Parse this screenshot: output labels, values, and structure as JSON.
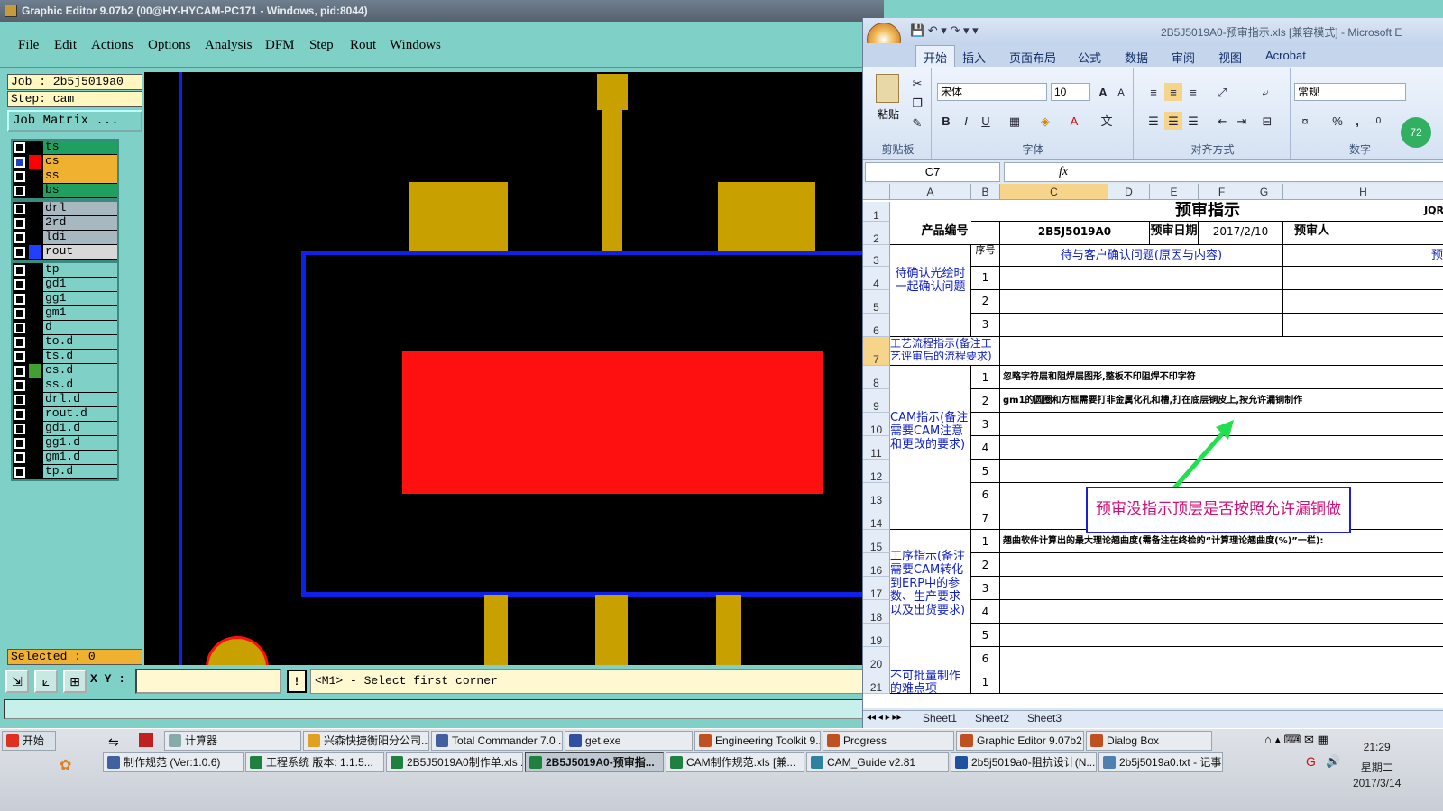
{
  "ge": {
    "title": "Graphic Editor 9.07b2 (00@HY-HYCAM-PC171 - Windows, pid:8044)",
    "menu": [
      "File",
      "Edit",
      "Actions",
      "Options",
      "Analysis",
      "DFM",
      "Step",
      "Rout",
      "Windows"
    ],
    "job_label": "Job : 2b5j5019a0",
    "step_label": "Step: cam",
    "job_matrix": "Job Matrix ...",
    "layers_group1": [
      {
        "name": "ts",
        "color": "#20a060",
        "checked": false,
        "edit": ""
      },
      {
        "name": "cs",
        "color": "#f0b030",
        "checked": true,
        "swatch": "#ff0000",
        "edit": "✎≡"
      },
      {
        "name": "ss",
        "color": "#f0b030",
        "checked": false,
        "edit": "✎"
      },
      {
        "name": "bs",
        "color": "#20a060",
        "checked": false,
        "edit": ""
      }
    ],
    "layers_group2": [
      {
        "name": "drl",
        "color": "#a8b8c0",
        "checked": false
      },
      {
        "name": "2rd",
        "color": "#a8b8c0",
        "checked": false
      },
      {
        "name": "ldi",
        "color": "#a8b8c0",
        "checked": false
      },
      {
        "name": "rout",
        "color": "#d8d8d8",
        "checked": false,
        "swatch": "#2040ff"
      }
    ],
    "layers_group3": [
      {
        "name": "tp",
        "edit": ""
      },
      {
        "name": "gd1",
        "edit": "✎"
      },
      {
        "name": "gg1",
        "edit": ""
      },
      {
        "name": "gm1",
        "edit": "✎"
      },
      {
        "name": "d",
        "edit": ""
      },
      {
        "name": "to.d",
        "edit": "✎"
      },
      {
        "name": "ts.d",
        "edit": ""
      },
      {
        "name": "cs.d",
        "edit": "✎",
        "swatch": "#40a030"
      },
      {
        "name": "ss.d",
        "edit": "✎"
      },
      {
        "name": "drl.d",
        "edit": ""
      },
      {
        "name": "rout.d",
        "edit": ""
      },
      {
        "name": "gd1.d",
        "edit": "✎"
      },
      {
        "name": "gg1.d",
        "edit": ""
      },
      {
        "name": "gm1.d",
        "edit": "✎"
      },
      {
        "name": "tp.d",
        "edit": ""
      }
    ],
    "selected": "Selected : 0",
    "xy_label": "X Y :",
    "bang": "!",
    "prompt": "<M1> - Select first corner",
    "colors": {
      "pad": "#c8a000",
      "fill": "#ff1010",
      "outline": "#1020e8",
      "bg": "#000000"
    }
  },
  "excel": {
    "title": "2B5J5019A0-预审指示.xls [兼容模式] - Microsoft E",
    "tabs": [
      "开始",
      "插入",
      "页面布局",
      "公式",
      "数据",
      "审阅",
      "视图",
      "Acrobat"
    ],
    "paste": "粘贴",
    "font_name": "宋体",
    "font_size": "10",
    "number_format": "常规",
    "groups": [
      "剪贴板",
      "字体",
      "对齐方式",
      "数字"
    ],
    "name_box": "C7",
    "fx": "fx",
    "columns": [
      "A",
      "B",
      "C",
      "D",
      "E",
      "F",
      "G",
      "H"
    ],
    "rows": [
      "1",
      "2",
      "3",
      "4",
      "5",
      "6",
      "7",
      "8",
      "9",
      "10",
      "11",
      "12",
      "13",
      "14",
      "15",
      "16",
      "17",
      "18",
      "19",
      "20",
      "21"
    ],
    "title_cell": "预审指示",
    "title_right": "JQR",
    "product_label": "产品编号",
    "product_value": "2B5J5019A0",
    "date_label": "预审日期",
    "date_value": "2017/2/10",
    "reviewer_label": "预审人",
    "seq_label": "序号",
    "pending_header": "待与客户确认问题(原因与内容)",
    "pending_right": "预",
    "sec_pending": "待确认光绘时一起确认问题",
    "sec_process": "工艺流程指示(备注工艺评审后的流程要求)",
    "sec_cam": "CAM指示(备注需要CAM注意和更改的要求)",
    "sec_work": "工序指示(备注需要CAM转化到ERP中的参数、生产要求以及出货要求)",
    "sec_hard": "不可批量制作的难点项",
    "cam_line1": "忽略字符层和阻焊层图形,整板不印阻焊不印字符",
    "cam_line2": "gm1的圆圈和方框需要打非金属化孔和槽,打在底层铜皮上,按允许漏铜制作",
    "work_line1": "翘曲软件计算出的最大理论翘曲度(需备注在终检的“计算理论翘曲度(%)”一栏):",
    "seq_nums_pending": [
      "1",
      "2",
      "3"
    ],
    "seq_nums_cam": [
      "1",
      "2",
      "3",
      "4",
      "5",
      "6",
      "7"
    ],
    "seq_nums_work": [
      "1",
      "2",
      "3",
      "4",
      "5",
      "6"
    ],
    "seq_nums_hard": [
      "1"
    ],
    "sheet_tabs": [
      "Sheet1",
      "Sheet2",
      "Sheet3"
    ],
    "callout": "预审没指示顶层是否按照允许漏铜做",
    "badge": "72"
  },
  "taskbar": {
    "start": "开始",
    "row1": [
      {
        "label": "计算器",
        "color": "#8aa"
      },
      {
        "label": "兴森快捷衡阳分公司...",
        "color": "#e0a020"
      },
      {
        "label": "Total Commander 7.0 ...",
        "color": "#4060a0"
      },
      {
        "label": "get.exe",
        "color": "#3050a0"
      },
      {
        "label": "Engineering Toolkit 9....",
        "color": "#c05020"
      },
      {
        "label": "Progress",
        "color": "#c05020"
      },
      {
        "label": "Graphic Editor 9.07b2 ...",
        "color": "#c05020"
      },
      {
        "label": "Dialog Box",
        "color": "#c05020"
      }
    ],
    "row2": [
      {
        "label": "制作规范 (Ver:1.0.6)",
        "color": "#4060a0"
      },
      {
        "label": "工程系统  版本: 1.1.5...",
        "color": "#208040"
      },
      {
        "label": "2B5J5019A0制作单.xls ...",
        "color": "#208040"
      },
      {
        "label": "2B5J5019A0-预审指...",
        "color": "#208040",
        "active": true
      },
      {
        "label": "CAM制作规范.xls [兼...",
        "color": "#208040"
      },
      {
        "label": "CAM_Guide v2.81",
        "color": "#3080a0"
      },
      {
        "label": "2b5j5019a0-阻抗设计(N...",
        "color": "#2050a0"
      },
      {
        "label": "2b5j5019a0.txt - 记事本",
        "color": "#5080b0"
      }
    ],
    "time": "21:29",
    "weekday": "星期二",
    "date": "2017/3/14"
  }
}
